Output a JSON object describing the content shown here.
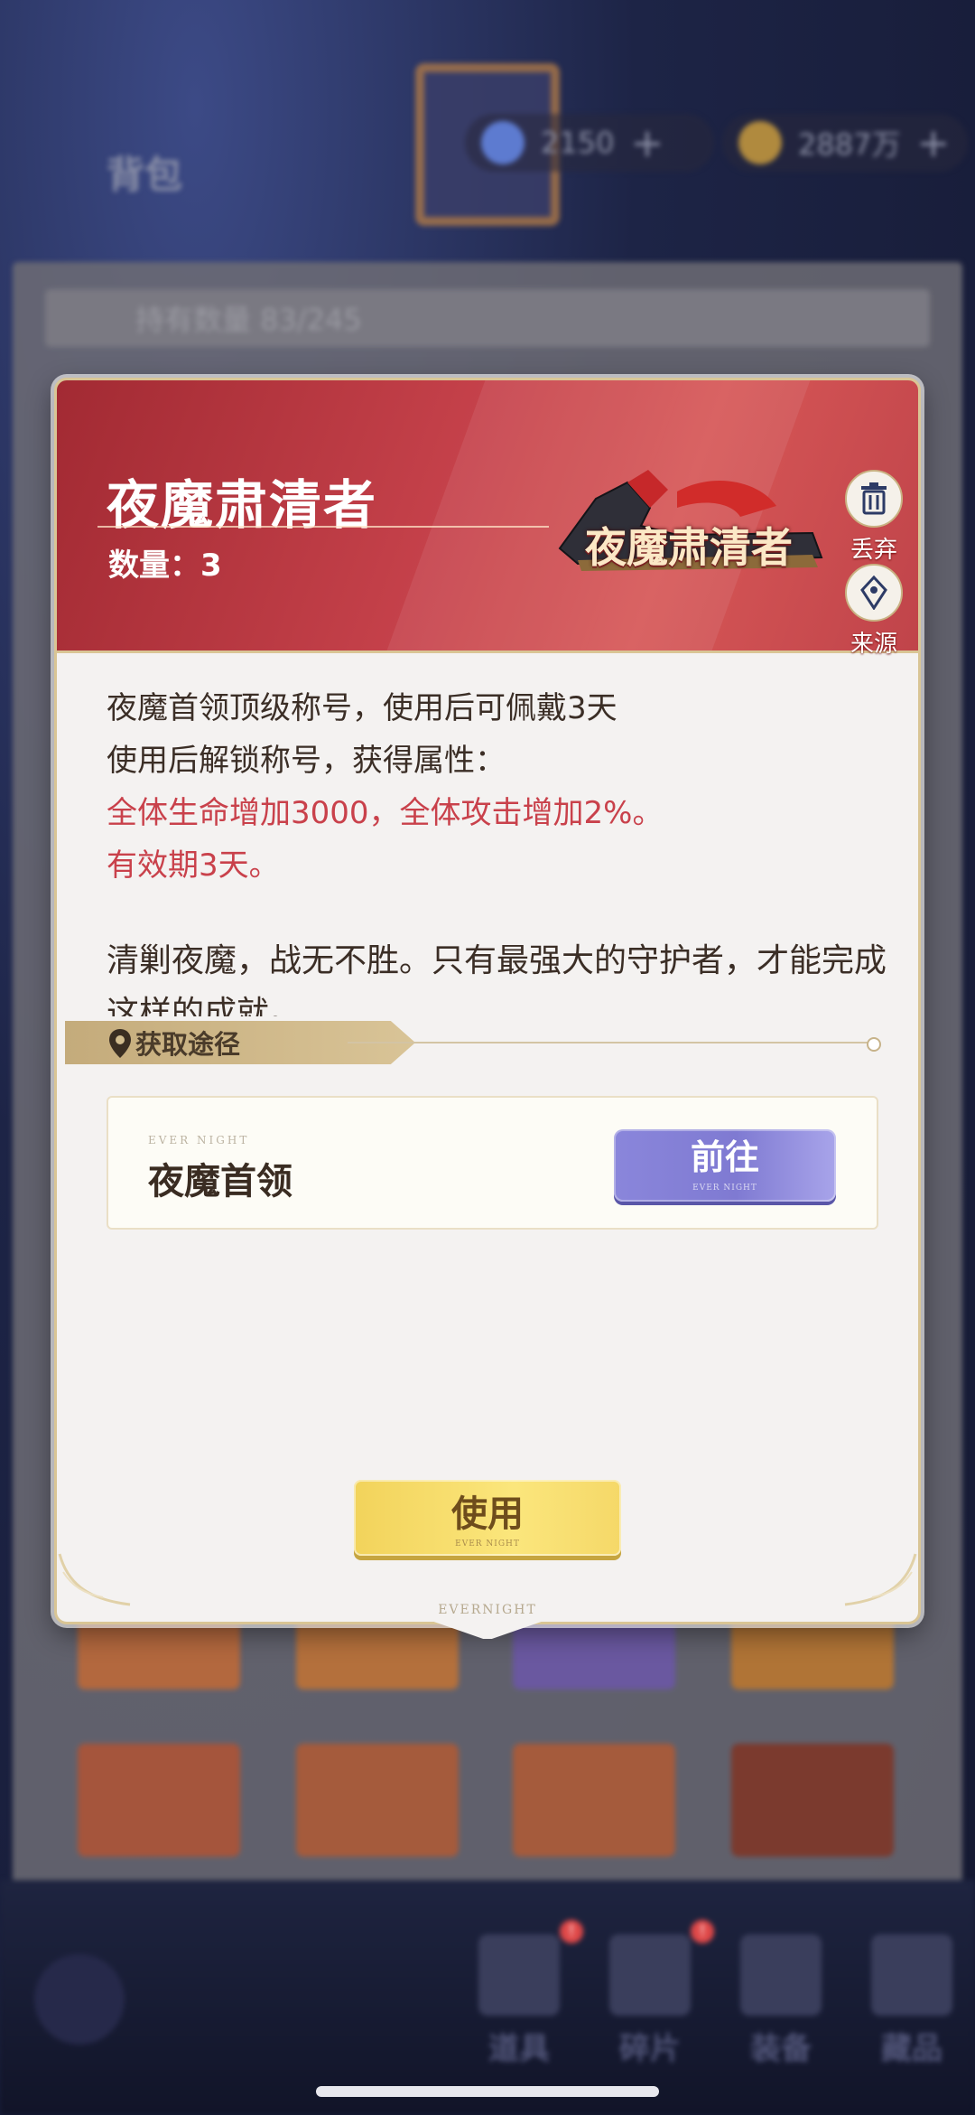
{
  "background": {
    "page_title": "背包",
    "currency_gems": "2150",
    "currency_gold": "2887万",
    "inventory_count": "持有数量 83/245",
    "nav": [
      {
        "label": "道具",
        "badge": "!"
      },
      {
        "label": "碎片",
        "badge": "!"
      },
      {
        "label": "装备",
        "badge": ""
      },
      {
        "label": "藏品",
        "badge": ""
      }
    ]
  },
  "item": {
    "name": "夜魔肃清者",
    "quantity": "数量：3",
    "title_art_text": "夜魔肃清者",
    "discard_label": "丢弃",
    "source_label": "来源",
    "description": "夜魔首领顶级称号，使用后可佩戴3天",
    "unlock_text": "使用后解锁称号，获得属性：",
    "attributes": "全体生命增加3000，全体攻击增加2%。",
    "validity": "有效期3天。",
    "flavor": "清剿夜魔，战无不胜。只有最强大的守护者，才能完成这样的成就。"
  },
  "acquire": {
    "section_label": "获取途径",
    "sources": [
      {
        "kicker": "EVER NIGHT",
        "name": "夜魔首领",
        "button": "前往",
        "button_sub": "EVER NIGHT"
      }
    ]
  },
  "actions": {
    "use_label": "使用",
    "use_sub": "EVER NIGHT"
  },
  "brand": "EVERNIGHT",
  "colors": {
    "banner_red": "#c5414a",
    "accent_red_text": "#c9414b",
    "go_button": "#7f7ad2",
    "use_button": "#f2d35b",
    "frame_gold": "#d9c595"
  }
}
